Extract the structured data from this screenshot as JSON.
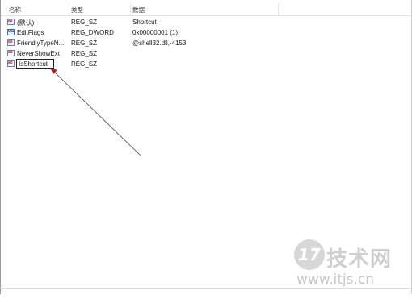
{
  "header": {
    "col_name": "名称",
    "col_type": "类型",
    "col_data": "数据"
  },
  "rows": [
    {
      "name": "(默认)",
      "type": "REG_SZ",
      "data": "Shortcut",
      "icon": "string-value-icon"
    },
    {
      "name": "EditFlags",
      "type": "REG_DWORD",
      "data": "0x00000001 (1)",
      "icon": "binary-value-icon"
    },
    {
      "name": "FriendlyTypeN...",
      "type": "REG_SZ",
      "data": "@shell32.dll,-4153",
      "icon": "string-value-icon"
    },
    {
      "name": "NeverShowExt",
      "type": "REG_SZ",
      "data": "",
      "icon": "string-value-icon"
    },
    {
      "name": "IsShortcut",
      "type": "REG_SZ",
      "data": "",
      "icon": "string-value-icon",
      "editing": true
    }
  ],
  "watermark": {
    "number": "17",
    "text": "技术网",
    "url": "www.itjs.cn"
  },
  "colors": {
    "arrow": "#b22222",
    "watermark": "#cccccc"
  }
}
